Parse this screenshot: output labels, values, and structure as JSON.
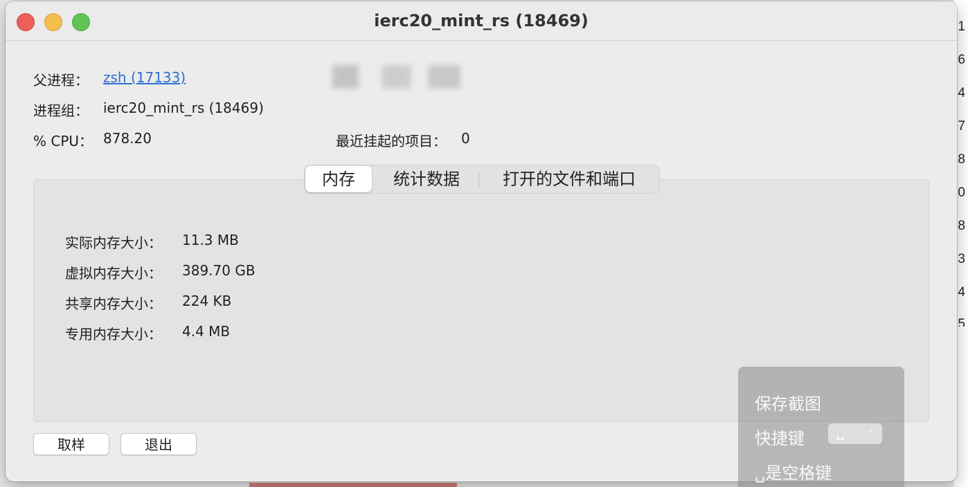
{
  "window": {
    "title": "ierc20_mint_rs (18469)"
  },
  "info": {
    "parent_label": "父进程：",
    "parent_value": "zsh (17133)",
    "group_label": "进程组：",
    "group_value": "ierc20_mint_rs (18469)",
    "cpu_label": "% CPU：",
    "cpu_value": "878.20",
    "suspended_label": "最近挂起的项目：",
    "suspended_value": "0"
  },
  "tabs": [
    {
      "label": "内存",
      "active": true
    },
    {
      "label": "统计数据",
      "active": false
    },
    {
      "label": "打开的文件和端口",
      "active": false
    }
  ],
  "memory": [
    {
      "label": "实际内存大小：",
      "value": "11.3 MB"
    },
    {
      "label": "虚拟内存大小：",
      "value": "389.70 GB"
    },
    {
      "label": "共享内存大小：",
      "value": "224 KB"
    },
    {
      "label": "专用内存大小：",
      "value": "4.4 MB"
    }
  ],
  "buttons": {
    "sample": "取样",
    "quit": "退出"
  },
  "screenshot_overlay": {
    "save_label": "保存截图",
    "shortcut_label": "快捷键",
    "shortcut_value": "␣",
    "note": "␣是空格键"
  },
  "background": {
    "digits": [
      "1",
      "6",
      "4",
      "7",
      "8",
      "0",
      "8",
      "3",
      "4",
      "5"
    ]
  },
  "colors": {
    "link": "#2a6fd1",
    "close": "#ed5f57",
    "minimize": "#f5be4f",
    "maximize": "#5fc454"
  }
}
